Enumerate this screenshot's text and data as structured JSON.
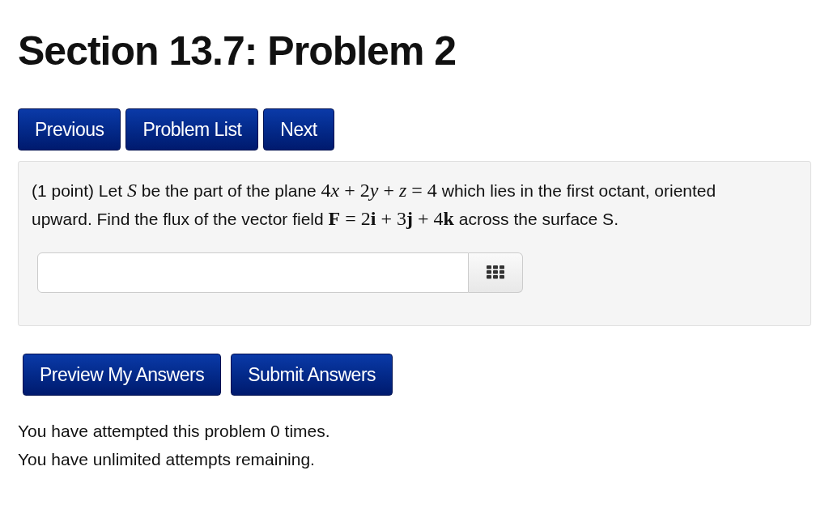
{
  "title": "Section 13.7: Problem 2",
  "nav_buttons": [
    "Previous",
    "Problem List",
    "Next"
  ],
  "problem": {
    "segments": [
      {
        "kind": "text",
        "text": "(1 point) Let "
      },
      {
        "kind": "var",
        "text": "S"
      },
      {
        "kind": "text",
        "text": " be the part of the plane "
      },
      {
        "kind": "num",
        "text": "4"
      },
      {
        "kind": "var",
        "text": "x"
      },
      {
        "kind": "num",
        "text": " + 2"
      },
      {
        "kind": "var",
        "text": "y"
      },
      {
        "kind": "num",
        "text": " + "
      },
      {
        "kind": "var",
        "text": "z"
      },
      {
        "kind": "num",
        "text": " = 4"
      },
      {
        "kind": "text",
        "text": " which lies in the first octant, oriented upward. Find the flux of the vector field "
      },
      {
        "kind": "vec",
        "text": "F"
      },
      {
        "kind": "num",
        "text": " = 2"
      },
      {
        "kind": "vec",
        "text": "i"
      },
      {
        "kind": "num",
        "text": " + 3"
      },
      {
        "kind": "vec",
        "text": "j"
      },
      {
        "kind": "num",
        "text": " + 4"
      },
      {
        "kind": "vec",
        "text": "k"
      },
      {
        "kind": "text",
        "text": " across the surface S."
      }
    ]
  },
  "action_buttons": [
    "Preview My Answers",
    "Submit Answers"
  ],
  "messages": [
    "You have attempted this problem 0 times.",
    "You have unlimited attempts remaining."
  ]
}
